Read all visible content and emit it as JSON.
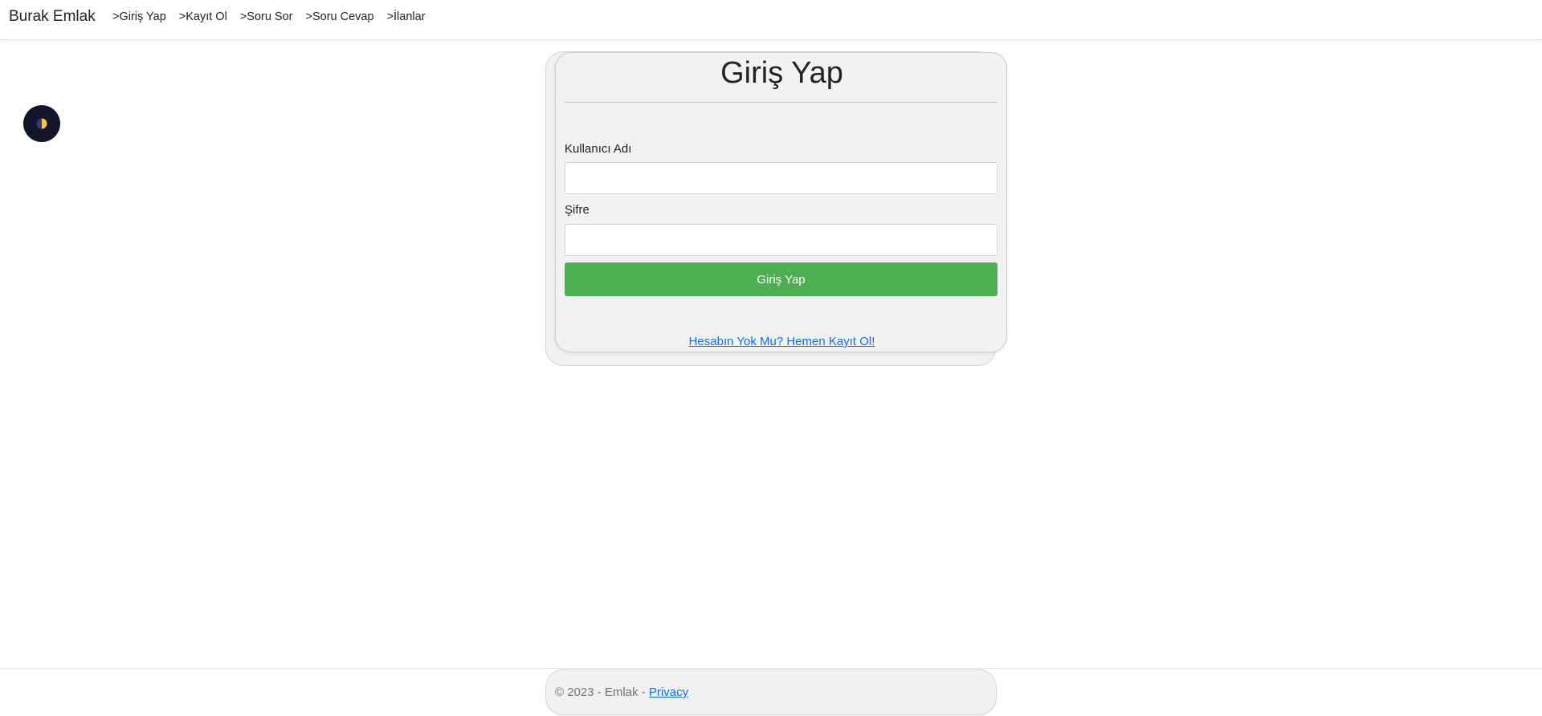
{
  "navbar": {
    "brand": "Burak Emlak",
    "links": [
      {
        "label": ">Giriş Yap"
      },
      {
        "label": ">Kayıt Ol"
      },
      {
        "label": ">Soru Sor"
      },
      {
        "label": ">Soru Cevap"
      },
      {
        "label": ">İlanlar"
      }
    ]
  },
  "theme_toggle": {
    "icon": "half-moon-icon",
    "colors": {
      "background": "#14142b",
      "light_half": "#f5c842",
      "dark_half": "#3a3a7a"
    }
  },
  "login": {
    "title": "Giriş Yap",
    "username_label": "Kullanıcı Adı",
    "username_value": "",
    "password_label": "Şifre",
    "password_value": "",
    "submit_label": "Giriş Yap",
    "register_link": "Hesabın Yok Mu? Hemen Kayıt Ol!"
  },
  "footer": {
    "copyright": "© 2023 - Emlak - ",
    "privacy_link": "Privacy"
  },
  "colors": {
    "accent_button": "#4caf50",
    "link": "#0d6efd",
    "card_background": "#f2f2f2"
  }
}
